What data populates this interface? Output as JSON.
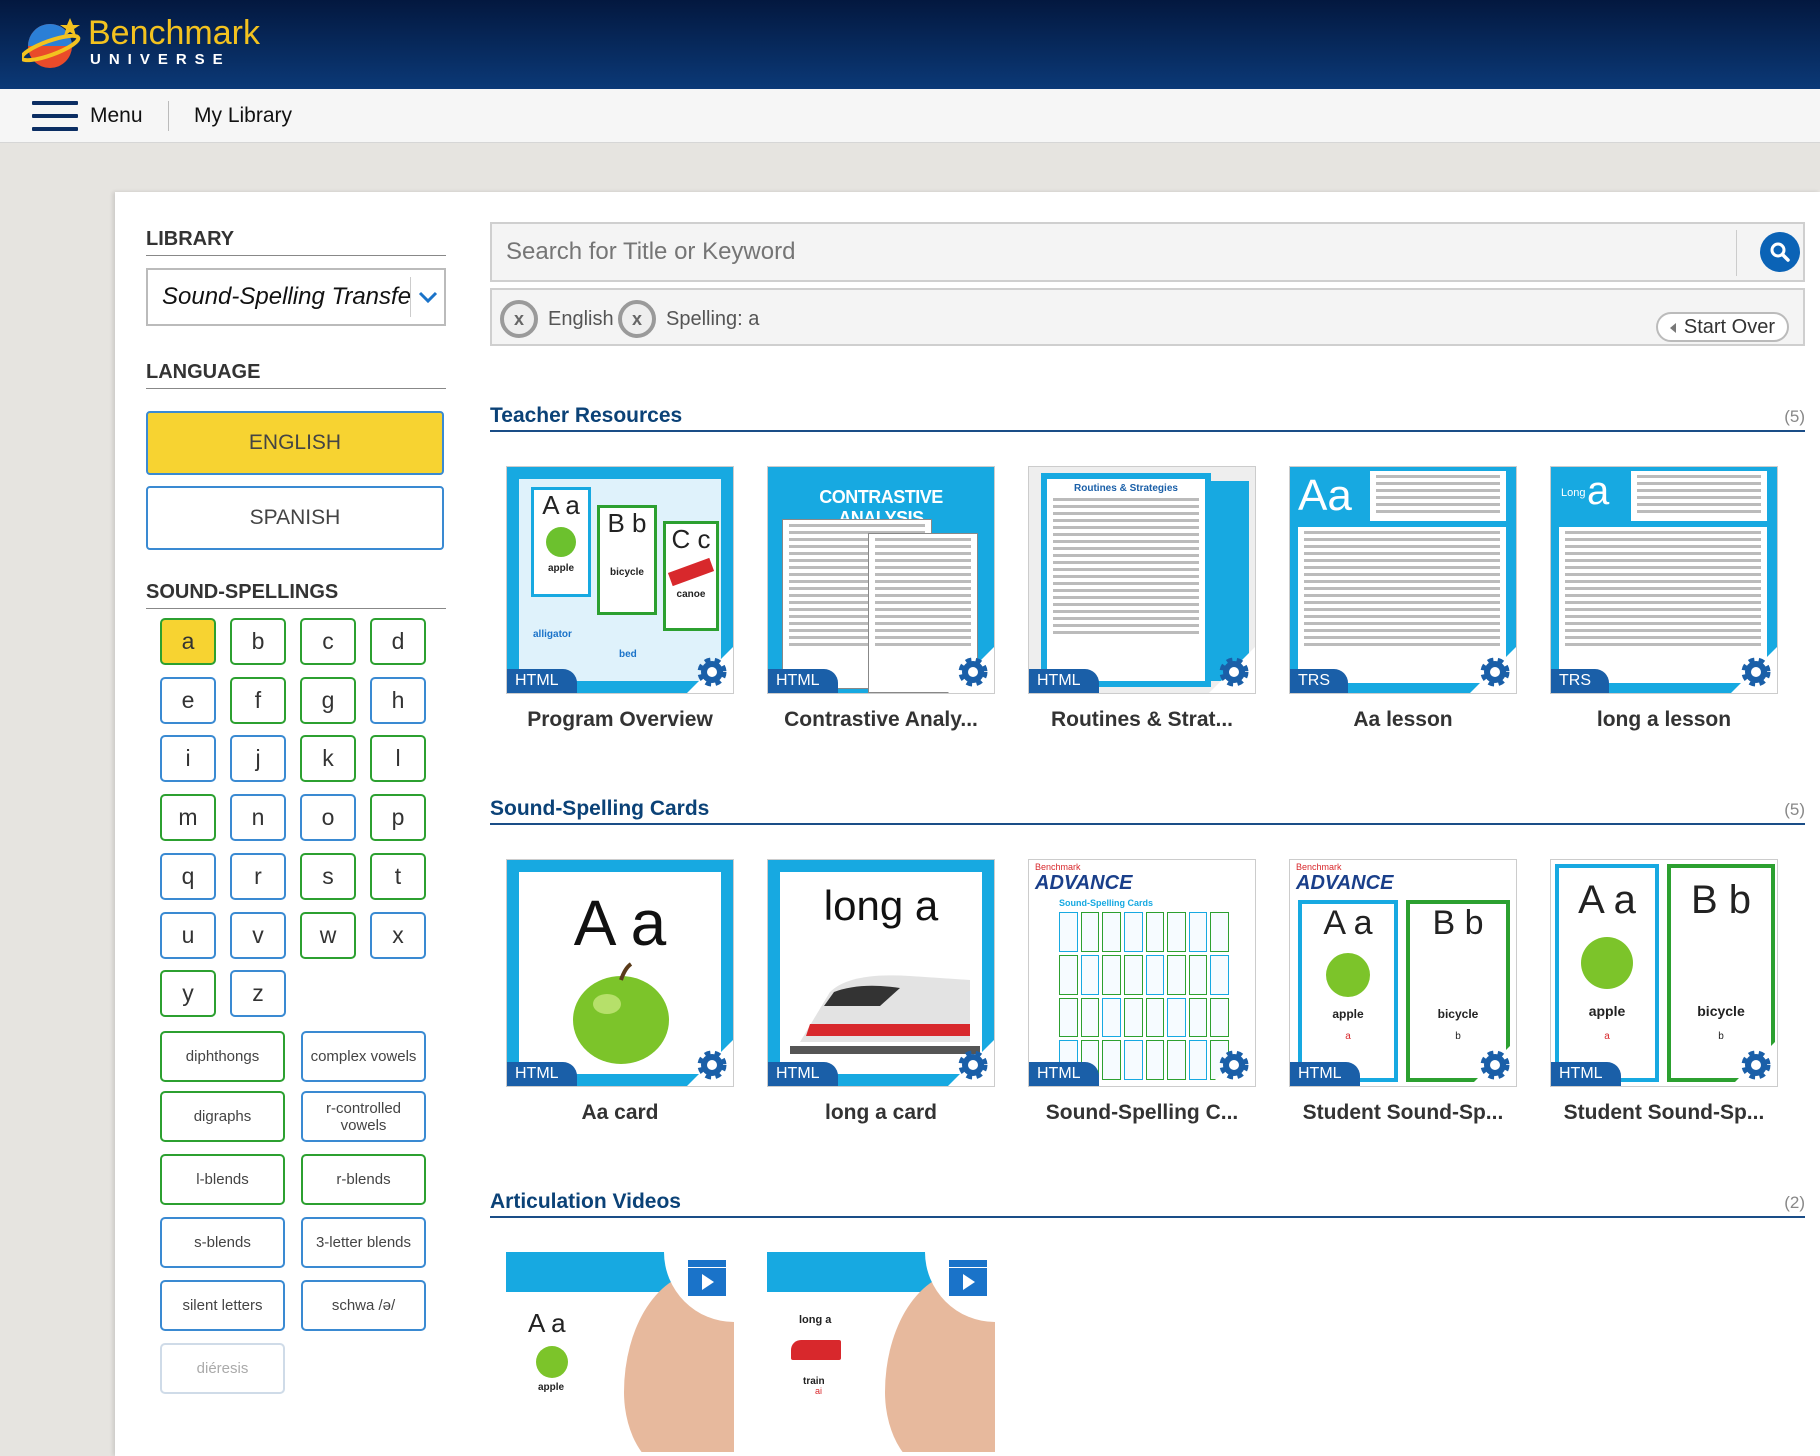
{
  "header": {
    "brand_name": "Benchmark",
    "brand_sub": "UNIVERSE"
  },
  "nav": {
    "menu_label": "Menu",
    "my_library_label": "My Library"
  },
  "sidebar": {
    "library_heading": "LIBRARY",
    "library_selected": "Sound-Spelling Transfer",
    "language_heading": "LANGUAGE",
    "languages": [
      {
        "label": "ENGLISH",
        "selected": true
      },
      {
        "label": "SPANISH",
        "selected": false
      }
    ],
    "sound_spellings_heading": "SOUND-SPELLINGS",
    "letters": [
      "a",
      "b",
      "c",
      "d",
      "e",
      "f",
      "g",
      "h",
      "i",
      "j",
      "k",
      "l",
      "m",
      "n",
      "o",
      "p",
      "q",
      "r",
      "s",
      "t",
      "u",
      "v",
      "w",
      "x",
      "y",
      "z"
    ],
    "groups": [
      "diphthongs",
      "complex vowels",
      "digraphs",
      "r-controlled vowels",
      "l-blends",
      "r-blends",
      "s-blends",
      "3-letter blends",
      "silent letters",
      "schwa /ə/",
      "diéresis"
    ]
  },
  "search": {
    "placeholder": "Search for Title or Keyword"
  },
  "filters": {
    "chips": [
      "English",
      "Spelling: a"
    ],
    "start_over_label": "Start Over"
  },
  "sections": [
    {
      "title": "Teacher Resources",
      "count": "(5)",
      "items": [
        {
          "title": "Program Overview",
          "tag": "HTML"
        },
        {
          "title": "Contrastive Analy...",
          "tag": "HTML"
        },
        {
          "title": "Routines & Strat...",
          "tag": "HTML"
        },
        {
          "title": "Aa lesson",
          "tag": "TRS"
        },
        {
          "title": "long a lesson",
          "tag": "TRS"
        }
      ]
    },
    {
      "title": "Sound-Spelling Cards",
      "count": "(5)",
      "items": [
        {
          "title": "Aa card",
          "tag": "HTML"
        },
        {
          "title": "long a card",
          "tag": "HTML"
        },
        {
          "title": "Sound-Spelling C...",
          "tag": "HTML"
        },
        {
          "title": "Student Sound-Sp...",
          "tag": "HTML"
        },
        {
          "title": "Student Sound-Sp...",
          "tag": "HTML"
        }
      ]
    },
    {
      "title": "Articulation Videos",
      "count": "(2)",
      "items": []
    }
  ],
  "thumb_text": {
    "overview": {
      "l1": "A a",
      "l2": "B b",
      "l3": "C c",
      "w1": "apple",
      "w2": "bicycle",
      "w3": "canoe",
      "w4": "alligator",
      "w5": "bed"
    },
    "contrastive": "CONTRASTIVE ANALYSIS",
    "routines": "Routines & Strategies",
    "aa_lesson": "Aa",
    "long_lesson_small": "Long",
    "long_lesson_big": "a",
    "aa_card": "A a",
    "long_card": "long a",
    "advance": "ADVANCE",
    "benchmark_small": "Benchmark",
    "ss_cards": "Sound-Spelling Cards",
    "ab_big_a": "A a",
    "ab_big_b": "B b",
    "apple": "apple",
    "bicycle": "bicycle",
    "small_a": "a",
    "small_b": "b",
    "vid1_letters": "A a",
    "vid1_word": "apple",
    "vid2_letters": "long a",
    "vid2_word": "train",
    "vid2_small": "ai"
  },
  "colors": {
    "brand_yellow": "#f7d331",
    "accent_blue": "#17a9e1",
    "link_blue": "#0b4277",
    "green_border": "#2ca030"
  }
}
